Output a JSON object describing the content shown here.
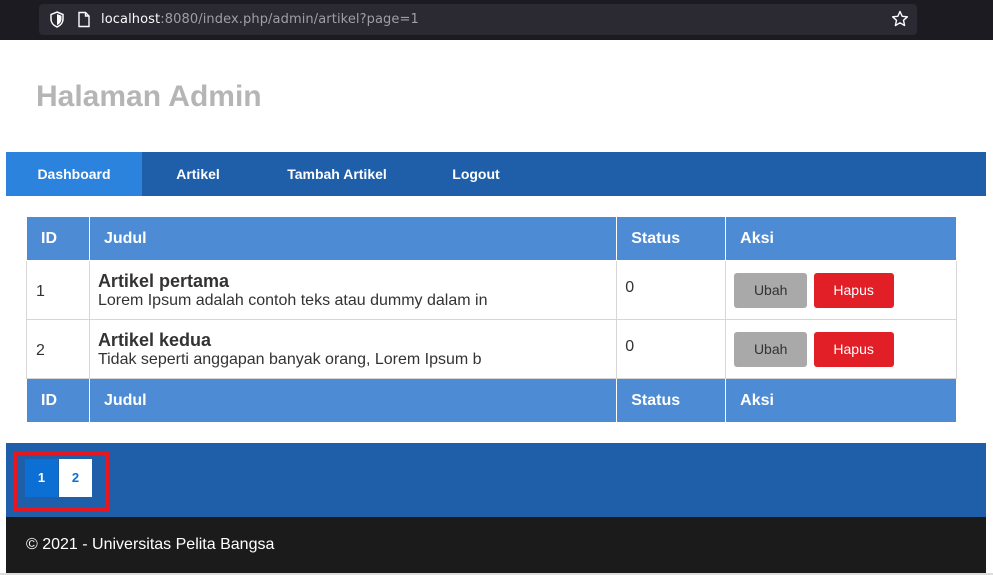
{
  "browser": {
    "url_host": "localhost",
    "url_rest": ":8080/index.php/admin/artikel?page=1",
    "icons": [
      "shield-icon",
      "page-icon",
      "star-icon"
    ]
  },
  "header": {
    "title": "Halaman Admin"
  },
  "nav": {
    "items": [
      {
        "label": "Dashboard",
        "active": true
      },
      {
        "label": "Artikel",
        "active": false
      },
      {
        "label": "Tambah Artikel",
        "active": false
      },
      {
        "label": "Logout",
        "active": false
      }
    ]
  },
  "table": {
    "columns": [
      "ID",
      "Judul",
      "Status",
      "Aksi"
    ],
    "rows": [
      {
        "id": "1",
        "title": "Artikel pertama",
        "excerpt": "Lorem Ipsum adalah contoh teks atau dummy dalam in",
        "status": "0",
        "edit_label": "Ubah",
        "delete_label": "Hapus"
      },
      {
        "id": "2",
        "title": "Artikel kedua",
        "excerpt": "Tidak seperti anggapan banyak orang, Lorem Ipsum b",
        "status": "0",
        "edit_label": "Ubah",
        "delete_label": "Hapus"
      }
    ]
  },
  "pagination": {
    "pages": [
      "1",
      "2"
    ],
    "current": "1"
  },
  "footer": {
    "text": "© 2021 - Universitas Pelita Bangsa"
  },
  "colors": {
    "nav_bg": "#1f5faa",
    "nav_active": "#2b83dd",
    "table_header": "#4d8bd4",
    "delete_button": "#e21f26",
    "edit_button": "#a9a9a9",
    "footer_bg": "#1b1b1b",
    "highlight": "#e8161f"
  }
}
